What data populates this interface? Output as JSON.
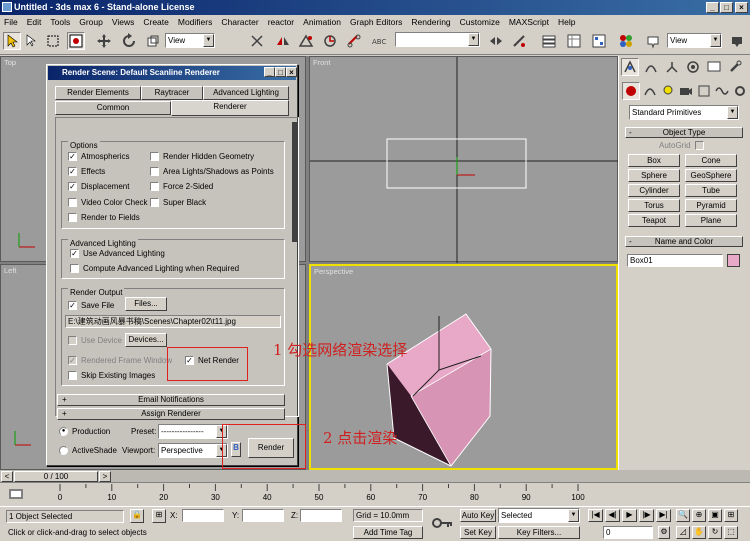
{
  "window": {
    "title": "Untitled - 3ds max 6 - Stand-alone License"
  },
  "menu": [
    "File",
    "Edit",
    "Tools",
    "Group",
    "Views",
    "Create",
    "Modifiers",
    "Character",
    "reactor",
    "Animation",
    "Graph Editors",
    "Rendering",
    "Customize",
    "MAXScript",
    "Help"
  ],
  "toolbar": {
    "refcoord": "View",
    "refcoord2": "View"
  },
  "viewports": {
    "top": "Top",
    "front": "Front",
    "left": "Left",
    "perspective": "Perspective"
  },
  "dialog": {
    "title": "Render Scene: Default Scanline Renderer",
    "tabs_row1": [
      "Render Elements",
      "Raytracer",
      "Advanced Lighting"
    ],
    "tabs_row2": [
      "Common",
      "Renderer"
    ],
    "options": {
      "title": "Options",
      "items": [
        {
          "label": "Atmospherics",
          "checked": true
        },
        {
          "label": "Render Hidden Geometry",
          "checked": false
        },
        {
          "label": "Effects",
          "checked": true
        },
        {
          "label": "Area Lights/Shadows as Points",
          "checked": false
        },
        {
          "label": "Displacement",
          "checked": true
        },
        {
          "label": "Force 2-Sided",
          "checked": false
        },
        {
          "label": "Video Color Check",
          "checked": false
        },
        {
          "label": "Super Black",
          "checked": false
        },
        {
          "label": "Render to Fields",
          "checked": false
        }
      ]
    },
    "advanced_lighting": {
      "title": "Advanced Lighting",
      "use": "Use Advanced Lighting",
      "compute": "Compute Advanced Lighting when Required"
    },
    "render_output": {
      "title": "Render Output",
      "save_file": "Save File",
      "files_button": "Files...",
      "path": "E:\\建筑动画风暴书稿\\Scenes\\Chapter02\\t11.jpg",
      "use_device": "Use Device",
      "devices_button": "Devices...",
      "rendered_frame_window": "Rendered Frame Window",
      "net_render": "Net Render",
      "skip_existing": "Skip Existing Images"
    },
    "rollouts": [
      "Email Notifications",
      "Assign Renderer"
    ],
    "bottom": {
      "production": "Production",
      "activeshade": "ActiveShade",
      "preset_label": "Preset:",
      "preset_value": "----------------",
      "viewport_label": "Viewport:",
      "viewport_value": "Perspective",
      "render_button": "Render"
    }
  },
  "annotations": {
    "step1": "1  勾选网络渲染选择",
    "step2": "2  点击渲染"
  },
  "command_panel": {
    "dropdown": "Standard Primitives",
    "object_type": "Object Type",
    "autogrid": "AutoGrid",
    "buttons": [
      "Box",
      "Cone",
      "Sphere",
      "GeoSphere",
      "Cylinder",
      "Tube",
      "Torus",
      "Pyramid",
      "Teapot",
      "Plane"
    ],
    "name_color": "Name and Color",
    "object_name": "Box01",
    "object_color": "#e8a8c8"
  },
  "timeline": {
    "frame": "0 / 100",
    "ticks": [
      "0",
      "10",
      "20",
      "30",
      "40",
      "50",
      "60",
      "70",
      "80",
      "90",
      "100"
    ]
  },
  "status": {
    "selected": "1 Object Selected",
    "prompt": "Click or click-and-drag to select objects",
    "x_label": "X:",
    "y_label": "Y:",
    "z_label": "Z:",
    "grid": "Grid = 10.0mm",
    "add_time_tag": "Add Time Tag",
    "auto_key": "Auto Key",
    "set_key": "Set Key",
    "selected_dropdown": "Selected",
    "key_filters": "Key Filters...",
    "current_frame": "0"
  },
  "colors": {
    "viewport_active": "#f0e000",
    "box_face": "#e8a8c8",
    "annotation": "#d02020"
  }
}
